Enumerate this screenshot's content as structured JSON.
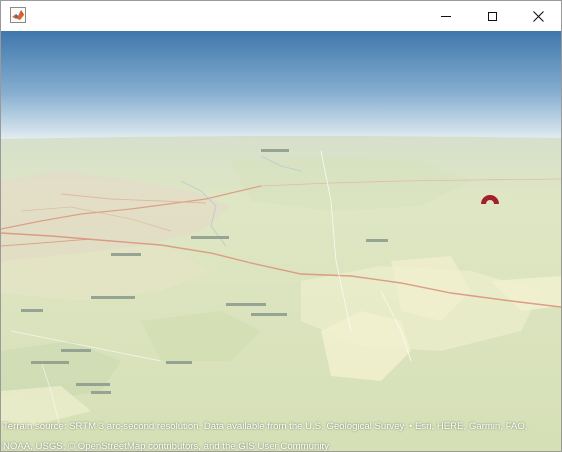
{
  "window": {
    "title": "",
    "app_icon": "matlab-icon",
    "controls": [
      "minimize-icon",
      "maximize-icon",
      "close-icon"
    ]
  },
  "globe": {
    "attribution": "Terrain source: SRTM 3 arc-second resolution. Data available from the U.S. Geological Survey. • Esri, HERE, Garmin, FAO, NOAA, USGS, © OpenStreetMap contributors, and the GIS User Community",
    "marker": "location-marker-icon"
  },
  "colors": {
    "sky_top": "#3f77ac",
    "sky_horizon": "#eef1f2",
    "terrain": "#dfe6c2",
    "road": "#d9957c",
    "marker": "#a21f2c"
  }
}
